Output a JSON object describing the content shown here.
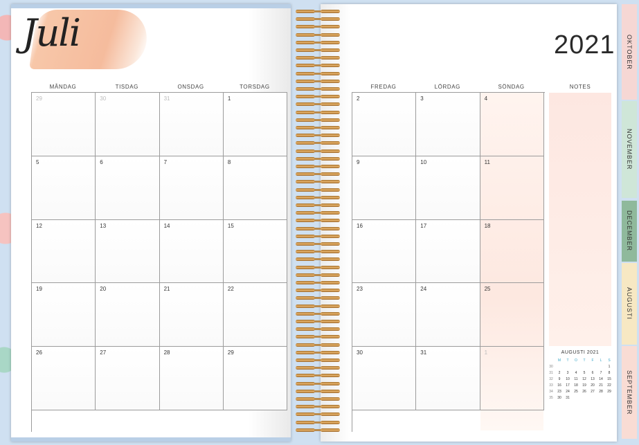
{
  "month_title": "Juli",
  "year": "2021",
  "left_day_headers": [
    "MÅNDAG",
    "TISDAG",
    "ONSDAG",
    "TORSDAG"
  ],
  "right_day_headers": [
    "FREDAG",
    "LÖRDAG",
    "SÖNDAG"
  ],
  "notes_label": "NOTES",
  "left_weeks": [
    [
      {
        "d": "29",
        "dim": true
      },
      {
        "d": "30",
        "dim": true
      },
      {
        "d": "31",
        "dim": true
      },
      {
        "d": "1"
      }
    ],
    [
      {
        "d": "5"
      },
      {
        "d": "6"
      },
      {
        "d": "7"
      },
      {
        "d": "8"
      }
    ],
    [
      {
        "d": "12"
      },
      {
        "d": "13"
      },
      {
        "d": "14"
      },
      {
        "d": "15"
      }
    ],
    [
      {
        "d": "19"
      },
      {
        "d": "20"
      },
      {
        "d": "21"
      },
      {
        "d": "22"
      }
    ],
    [
      {
        "d": "26"
      },
      {
        "d": "27"
      },
      {
        "d": "28"
      },
      {
        "d": "29"
      }
    ]
  ],
  "right_weeks": [
    [
      {
        "d": "2"
      },
      {
        "d": "3"
      },
      {
        "d": "4"
      }
    ],
    [
      {
        "d": "9"
      },
      {
        "d": "10"
      },
      {
        "d": "11"
      }
    ],
    [
      {
        "d": "16"
      },
      {
        "d": "17"
      },
      {
        "d": "18"
      }
    ],
    [
      {
        "d": "23"
      },
      {
        "d": "24"
      },
      {
        "d": "25"
      }
    ],
    [
      {
        "d": "30"
      },
      {
        "d": "31"
      },
      {
        "d": "1",
        "dim": true
      }
    ]
  ],
  "tabs": [
    {
      "label": "OKTOBER",
      "color": "#f6d7d4"
    },
    {
      "label": "NOVEMBER",
      "color": "#cfe6d8"
    },
    {
      "label": "DECEMBER",
      "color": "#8fb99c"
    },
    {
      "label": "AUGUSTI",
      "color": "#f7e8c3"
    },
    {
      "label": "SEPTEMBER",
      "color": "#f9dcd4"
    }
  ],
  "mini_calendar": {
    "title": "AUGUSTI 2021",
    "day_headers": [
      "",
      "M",
      "T",
      "O",
      "T",
      "F",
      "L",
      "S"
    ],
    "rows": [
      [
        "30",
        "",
        "",
        "",
        "",
        "",
        "",
        "1"
      ],
      [
        "31",
        "2",
        "3",
        "4",
        "5",
        "6",
        "7",
        "8"
      ],
      [
        "32",
        "9",
        "10",
        "11",
        "12",
        "13",
        "14",
        "15"
      ],
      [
        "33",
        "16",
        "17",
        "18",
        "19",
        "20",
        "21",
        "22"
      ],
      [
        "34",
        "23",
        "24",
        "25",
        "26",
        "27",
        "28",
        "29"
      ],
      [
        "35",
        "30",
        "31",
        "",
        "",
        "",
        "",
        ""
      ]
    ]
  }
}
